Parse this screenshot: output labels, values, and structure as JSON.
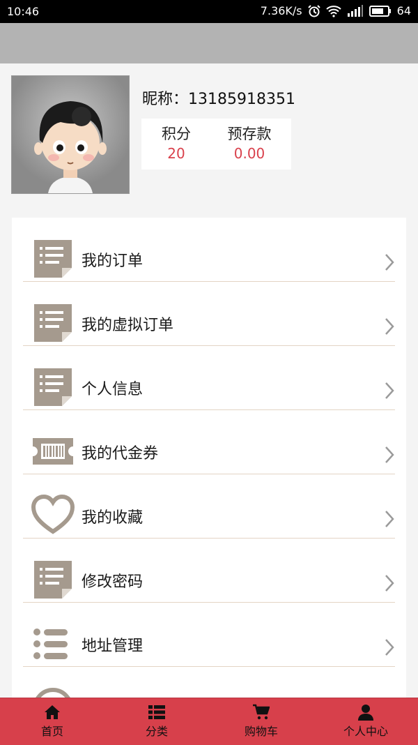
{
  "status_bar": {
    "time": "10:46",
    "network_speed": "7.36K/s",
    "battery": "64"
  },
  "profile": {
    "nickname": "昵称：13185918351",
    "points_label": "积分",
    "points_value": "20",
    "deposit_label": "预存款",
    "deposit_value": "0.00"
  },
  "menu": {
    "items": [
      {
        "label": "我的订单",
        "icon": "order-list-icon"
      },
      {
        "label": "我的虚拟订单",
        "icon": "order-list-icon"
      },
      {
        "label": "个人信息",
        "icon": "order-list-icon"
      },
      {
        "label": "我的代金券",
        "icon": "voucher-ticket-icon"
      },
      {
        "label": "我的收藏",
        "icon": "heart-icon"
      },
      {
        "label": "修改密码",
        "icon": "order-list-icon"
      },
      {
        "label": "地址管理",
        "icon": "bullet-list-icon"
      }
    ]
  },
  "tabbar": {
    "home": "首页",
    "category": "分类",
    "cart": "购物车",
    "profile": "个人中心"
  },
  "colors": {
    "accent": "#d7404b",
    "value_red": "#d9414c",
    "icon_gray": "#a59a8e"
  }
}
